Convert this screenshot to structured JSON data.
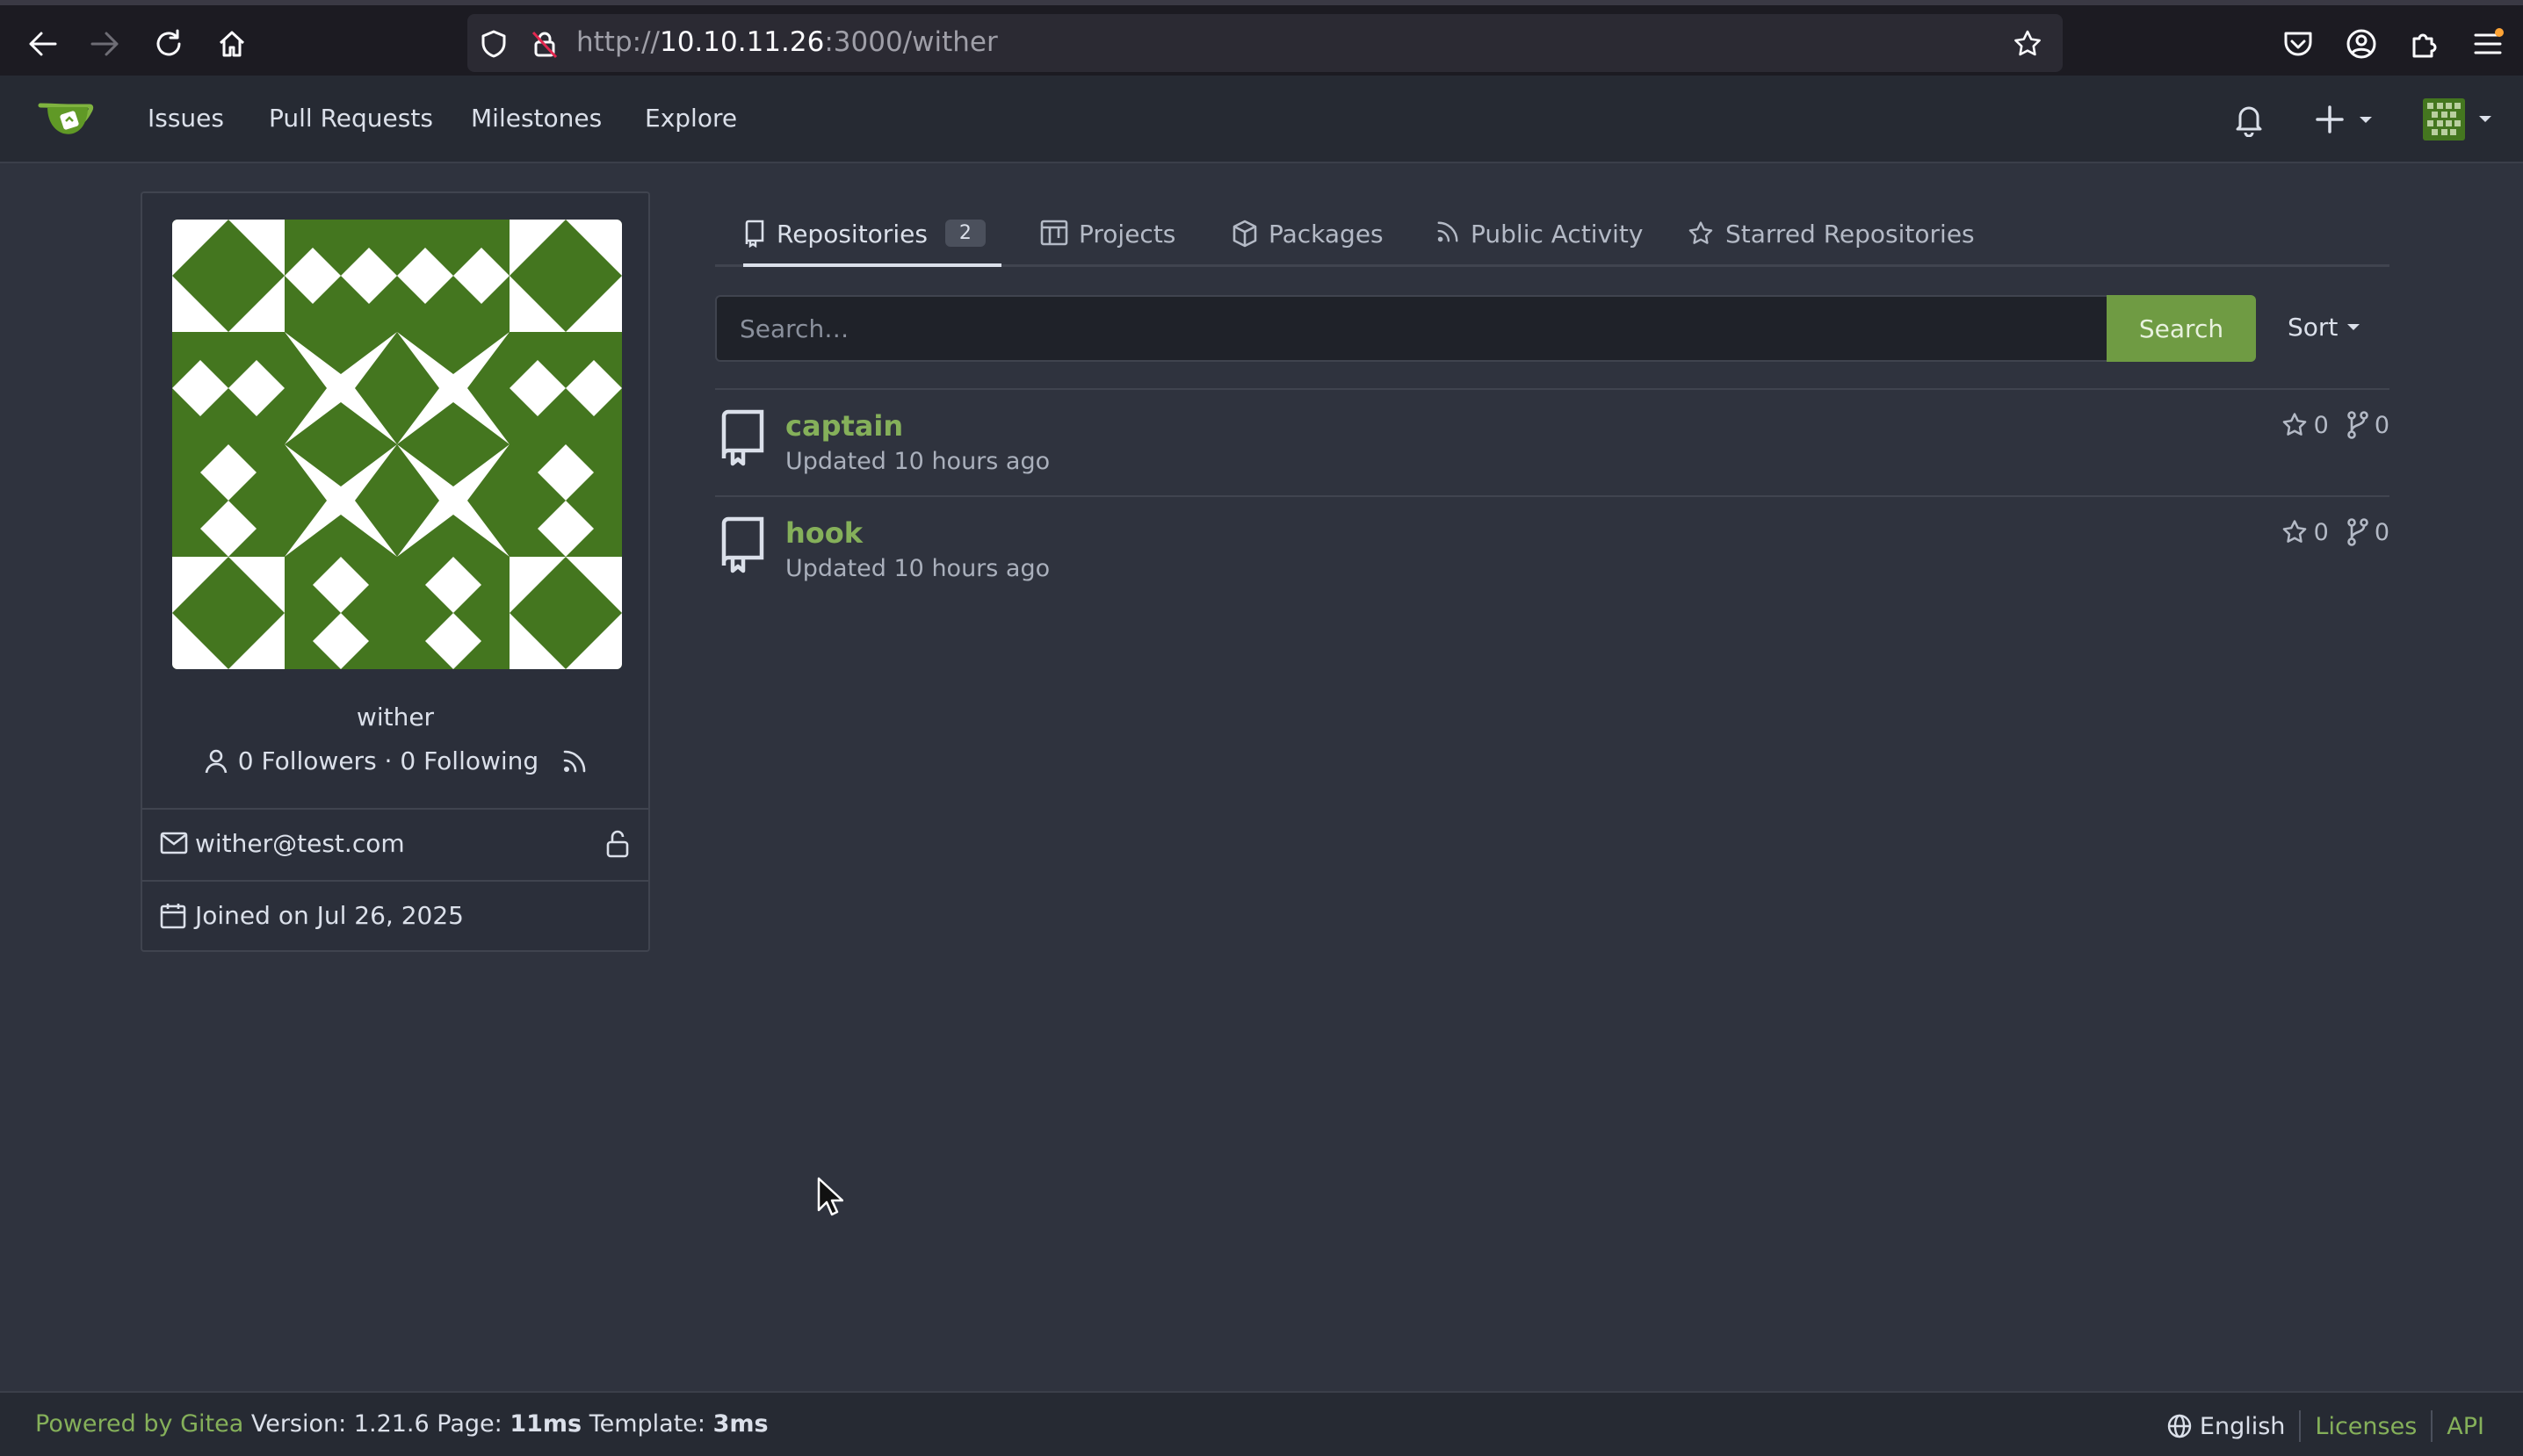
{
  "browser": {
    "url_prefix": "http://",
    "url_host": "10.10.11.26",
    "url_path": ":3000/wither"
  },
  "nav": {
    "items": [
      "Issues",
      "Pull Requests",
      "Milestones",
      "Explore"
    ]
  },
  "profile": {
    "username": "wither",
    "followers_text": "0 Followers · 0 Following",
    "email": "wither@test.com",
    "joined": "Joined on Jul 26, 2025"
  },
  "tabs": {
    "repositories": "Repositories",
    "repositories_count": "2",
    "projects": "Projects",
    "packages": "Packages",
    "public_activity": "Public Activity",
    "starred": "Starred Repositories"
  },
  "search": {
    "placeholder": "Search…",
    "button": "Search",
    "sort": "Sort"
  },
  "repos": [
    {
      "name": "captain",
      "updated": "Updated 10 hours ago",
      "stars": "0",
      "forks": "0"
    },
    {
      "name": "hook",
      "updated": "Updated 10 hours ago",
      "stars": "0",
      "forks": "0"
    }
  ],
  "footer": {
    "powered": "Powered by Gitea",
    "version": "Version: 1.21.6 Page:",
    "page_time": "11ms",
    "template_label": "Template:",
    "template_time": "3ms",
    "language": "English",
    "licenses": "Licenses",
    "api": "API"
  },
  "colors": {
    "accent": "#6f9b43",
    "link": "#85b05a",
    "background": "#2f333e",
    "avatar_green": "#44761f"
  }
}
